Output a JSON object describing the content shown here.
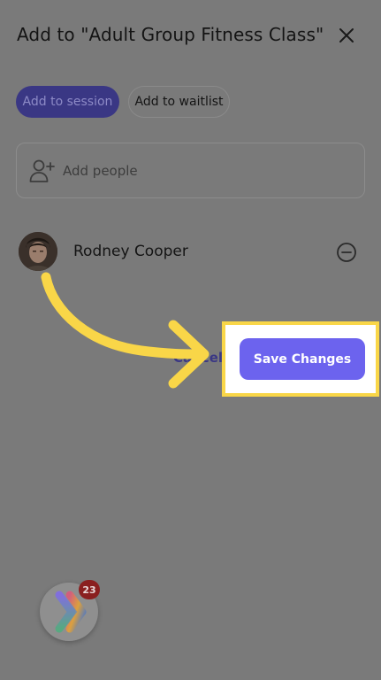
{
  "dialog": {
    "title": "Add to \"Adult Group Fitness Class\"",
    "close_icon": "close-icon"
  },
  "tabs": [
    {
      "label": "Add to session",
      "active": true
    },
    {
      "label": "Add to waitlist",
      "active": false
    }
  ],
  "add_people": {
    "label": "Add people",
    "icon": "add-person-icon"
  },
  "attendees": [
    {
      "name": "Rodney Cooper",
      "remove_icon": "minus-circle-icon"
    }
  ],
  "actions": {
    "cancel_label": "Cancel",
    "save_label": "Save Changes"
  },
  "launcher": {
    "badge_count": "23"
  },
  "colors": {
    "overlay": "#7a7a7a",
    "accent": "#6c63ee",
    "highlight": "#f9d648",
    "badge": "#8a1f1f"
  }
}
